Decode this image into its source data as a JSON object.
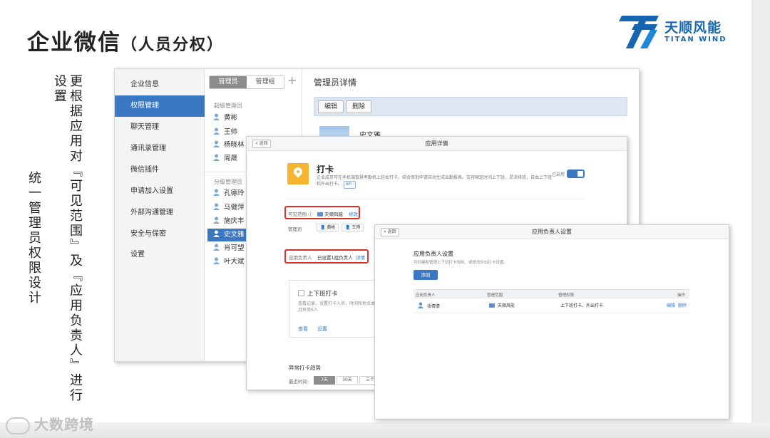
{
  "slide": {
    "title": "企业微信",
    "title_sub": "（人员分权）",
    "vertical_text_1": "更根据应用对『可见范围』及『应用负责人』进行设置",
    "vertical_text_2": "统一管理员权限设计",
    "watermark": "大数跨境",
    "logo": {
      "cn": "天顺风能",
      "en": "TITAN WIND",
      "color": "#1565b0"
    }
  },
  "admin_page": {
    "sidebar": [
      {
        "label": "企业信息",
        "active": false
      },
      {
        "label": "权限管理",
        "active": true
      },
      {
        "label": "聊天管理",
        "active": false
      },
      {
        "label": "通讯录管理",
        "active": false
      },
      {
        "label": "微信插件",
        "active": false
      },
      {
        "label": "申请加入设置",
        "active": false
      },
      {
        "label": "外部沟通管理",
        "active": false
      },
      {
        "label": "安全与保密",
        "active": false
      },
      {
        "label": "设置",
        "active": false
      }
    ],
    "tabs": {
      "admins": "管理员",
      "admin_groups": "管理组",
      "add": "+"
    },
    "super_admin_group": "超级管理员",
    "super_admins": [
      "黄彬",
      "王帅",
      "杨晓林",
      "周晟"
    ],
    "sub_admin_group": "分级管理员",
    "sub_admins": [
      "孔德玲",
      "马健萍",
      "施庆丰",
      "史文雅",
      "肖可望",
      "叶大斌"
    ],
    "selected_admin": "史文雅",
    "detail_title": "管理员详情",
    "edit_button": "编辑",
    "delete_button": "删除",
    "user_name": "史文雅",
    "accent_color": "#3b78c4"
  },
  "app_detail": {
    "back": "« 返回",
    "header_title": "应用详情",
    "app_name": "打卡",
    "app_desc": "企业成员可在手机端智慧考勤机上轻松打卡，结合审批申请自动生成出勤报表。支持固定时间上下班、灵活排班，自由上下班和外出打卡。",
    "api_tag": "API ›",
    "enabled_label": "已启用",
    "visible_scope_label": "可见范围 ⓘ",
    "visible_scope_value": "天顺风能",
    "visible_scope_edit": "修改",
    "admins_label": "管理员",
    "admins": [
      "黄彬",
      "王帅"
    ],
    "owner_label": "应用负责人",
    "owner_value": "已设置1组负责人",
    "owner_link": "详情",
    "card_title": "上下班打卡",
    "card_desc": "查看记录、设置打卡人员、时间和地点本月异常6人",
    "card_view": "查看",
    "card_settings": "设置",
    "abnormal_title": "异常打卡趋势",
    "range_label": "最近时间:",
    "ranges": [
      "7天",
      "30天",
      "三个"
    ]
  },
  "owner_settings": {
    "back": "« 返回",
    "header_title": "应用负责人设置",
    "section_title": "应用负责人设置",
    "section_desc": "可创建和管理上下班打卡规则、或修改外出打卡设置。",
    "add_button": "添加",
    "columns": [
      "应用负责人",
      "管理范围",
      "管理权限",
      "操作"
    ],
    "rows": [
      {
        "owner": "张倩倩",
        "scope": "天顺风能",
        "permission": "上下班打卡、外出打卡",
        "edit": "编辑",
        "delete": "删除"
      }
    ]
  }
}
